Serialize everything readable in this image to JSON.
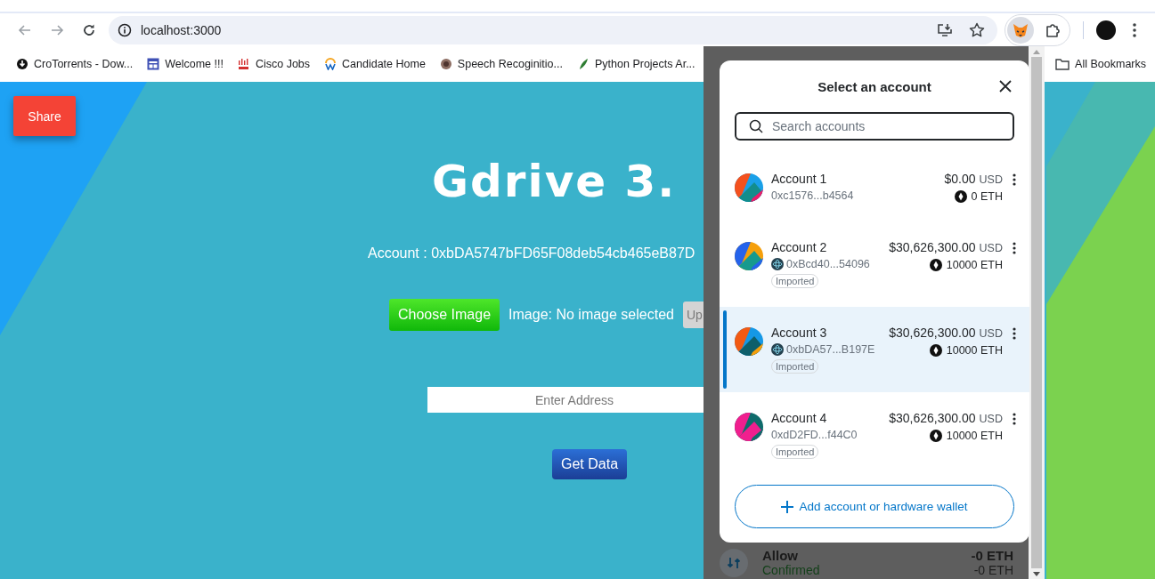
{
  "browser": {
    "address": "localhost:3000",
    "bookmarks": [
      {
        "label": "CroTorrents - Dow..."
      },
      {
        "label": "Welcome !!!"
      },
      {
        "label": "Cisco Jobs"
      },
      {
        "label": "Candidate Home"
      },
      {
        "label": "Speech Recoginitio..."
      },
      {
        "label": "Python Projects Ar..."
      }
    ],
    "all_bookmarks": "All Bookmarks"
  },
  "page": {
    "share_button": "Share",
    "title": "Gdrive 3.",
    "account_text": "Account : 0xbDA5747bFD65F08deb54cb465eB87D",
    "choose_button": "Choose Image",
    "image_status": "Image: No image selected",
    "upload_button": "Up",
    "address_placeholder": "Enter Address",
    "get_data_button": "Get Data"
  },
  "background_activity": {
    "title": "Allow",
    "amount": "-0 ETH",
    "status": "Confirmed",
    "status_amount": "-0 ETH"
  },
  "popup": {
    "title": "Select an account",
    "search_placeholder": "Search accounts",
    "accounts": [
      {
        "name": "Account 1",
        "address": "0xc1576...b4564",
        "balance": "$0.00",
        "currency": "USD",
        "eth": "0 ETH",
        "network_badge": false,
        "selected": false
      },
      {
        "name": "Account 2",
        "address": "0xBcd40...54096",
        "balance": "$30,626,300.00",
        "currency": "USD",
        "eth": "10000 ETH",
        "network_badge": true,
        "tag": "Imported",
        "selected": false
      },
      {
        "name": "Account 3",
        "address": "0xbDA57...B197E",
        "balance": "$30,626,300.00",
        "currency": "USD",
        "eth": "10000 ETH",
        "network_badge": true,
        "tag": "Imported",
        "selected": true
      },
      {
        "name": "Account 4",
        "address": "0xdD2FD...f44C0",
        "balance": "$30,626,300.00",
        "currency": "USD",
        "eth": "10000 ETH",
        "network_badge": false,
        "tag": "Imported",
        "selected": false
      }
    ],
    "add_button": "Add account or hardware wallet"
  }
}
